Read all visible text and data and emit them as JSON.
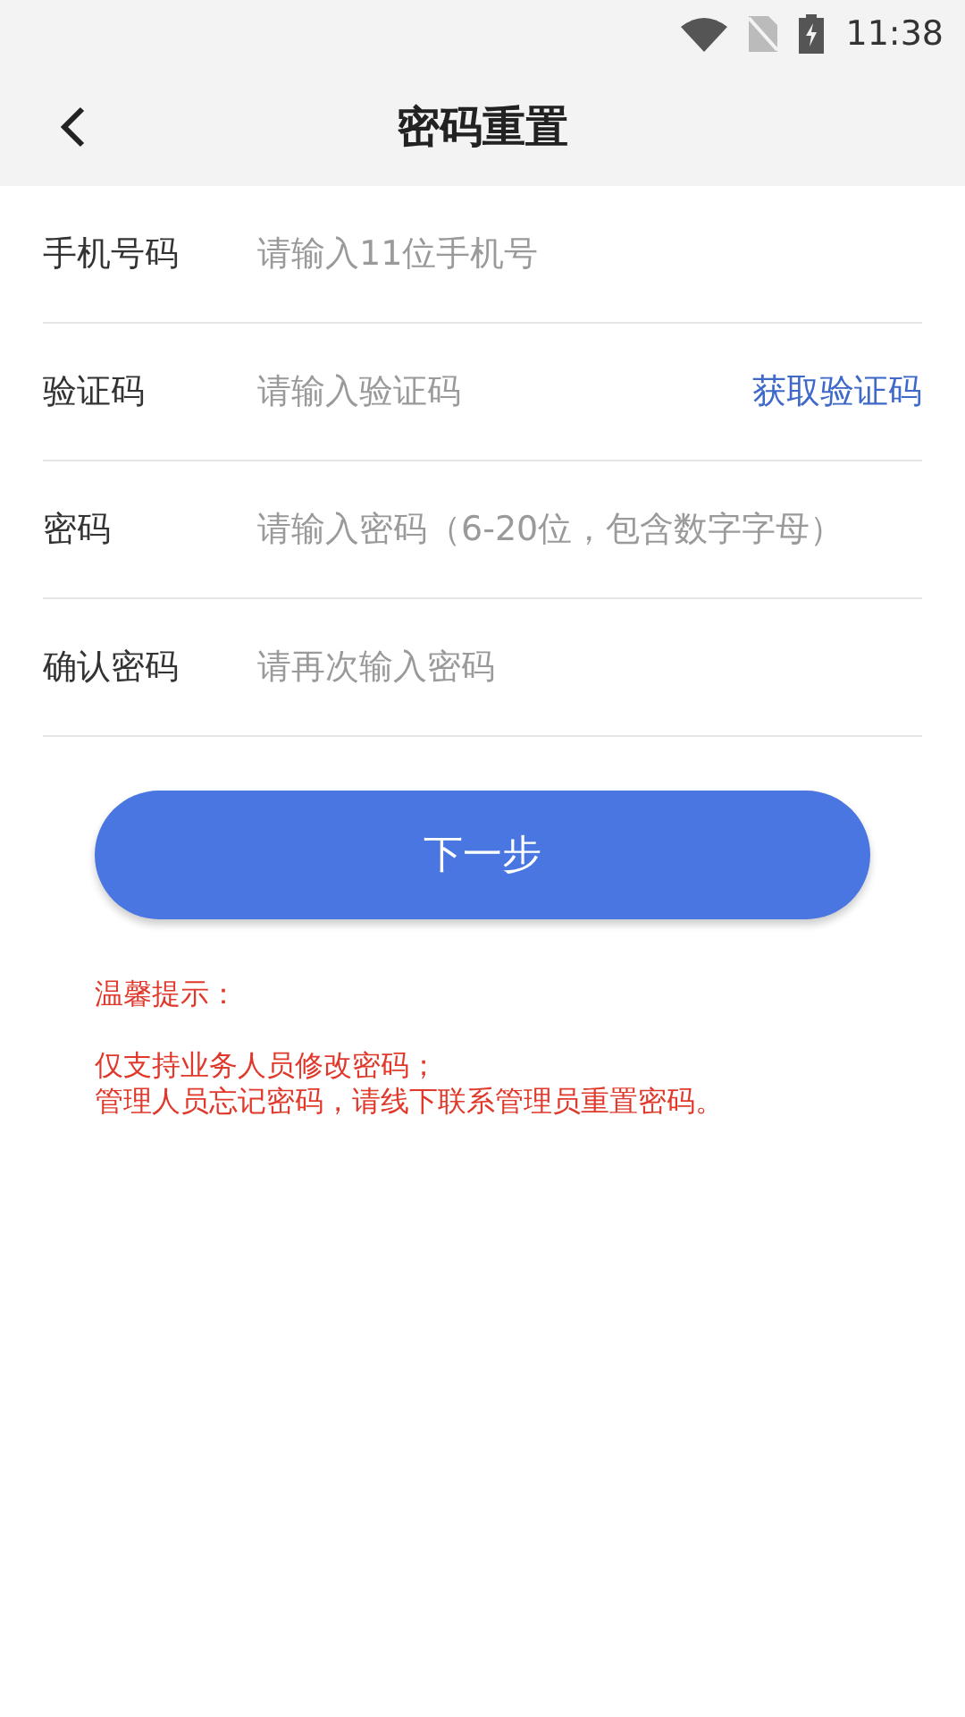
{
  "status_bar": {
    "time": "11:38"
  },
  "header": {
    "title": "密码重置"
  },
  "fields": [
    {
      "label": "手机号码",
      "placeholder": "请输入11位手机号"
    },
    {
      "label": "验证码",
      "placeholder": "请输入验证码",
      "action": "获取验证码"
    },
    {
      "label": "密码",
      "placeholder": "请输入密码（6-20位，包含数字字母）"
    },
    {
      "label": "确认密码",
      "placeholder": "请再次输入密码"
    }
  ],
  "submit_button": "下一步",
  "notice": {
    "title": "温馨提示：",
    "lines": [
      "仅支持业务人员修改密码；",
      "管理人员忘记密码，请线下联系管理员重置密码。"
    ]
  }
}
